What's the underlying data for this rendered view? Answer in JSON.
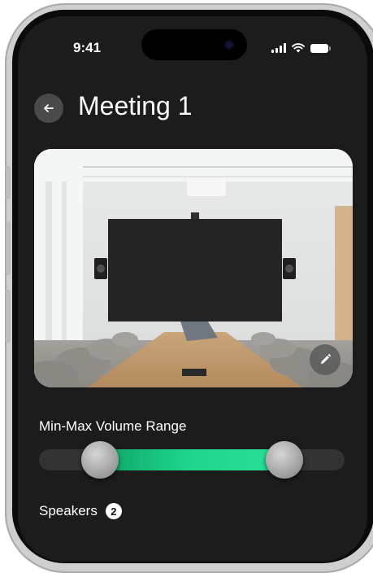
{
  "status_bar": {
    "time": "9:41",
    "signal_icon": "signal-bars-icon",
    "wifi_icon": "wifi-icon",
    "battery_icon": "battery-icon"
  },
  "header": {
    "back_icon": "arrow-left-icon",
    "title": "Meeting 1"
  },
  "room_photo": {
    "description": "conference room with large wall display, two speakers and long wooden table",
    "edit_icon": "pencil-icon"
  },
  "volume_range": {
    "label": "Min-Max Volume Range",
    "min_fraction": 0.2,
    "max_fraction": 0.8,
    "fill_color": "#1fd88c"
  },
  "speakers": {
    "label": "Speakers",
    "count": "2"
  }
}
